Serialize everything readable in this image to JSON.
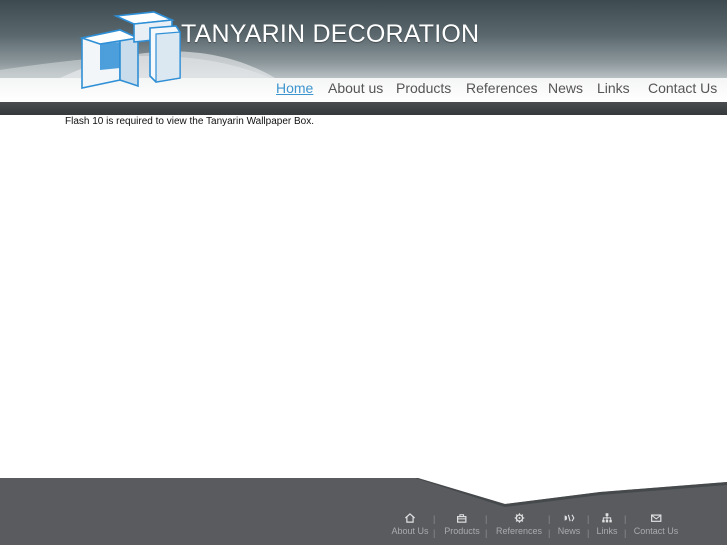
{
  "header": {
    "brand_name": "TANYARIN DECORATION"
  },
  "nav": {
    "items": [
      {
        "label": "Home",
        "active": true
      },
      {
        "label": "About us"
      },
      {
        "label": "Products"
      },
      {
        "label": "References"
      },
      {
        "label": "News"
      },
      {
        "label": "Links"
      },
      {
        "label": "Contact Us"
      }
    ]
  },
  "main": {
    "flash_notice": "Flash 10 is required to view the Tanyarin Wallpaper Box."
  },
  "footer": {
    "separator": "|",
    "items": [
      {
        "label": "About Us",
        "icon": "home-icon"
      },
      {
        "label": "Products",
        "icon": "box-icon"
      },
      {
        "label": "References",
        "icon": "gear-icon"
      },
      {
        "label": "News",
        "icon": "news-icon"
      },
      {
        "label": "Links",
        "icon": "sitemap-icon"
      },
      {
        "label": "Contact Us",
        "icon": "mail-icon"
      }
    ]
  },
  "colors": {
    "nav_active": "#3f95cf",
    "nav_text": "#555555",
    "header_dark": "#3d4a50",
    "footer_bg": "#595b5e",
    "logo_blue": "#2f8fd6"
  }
}
